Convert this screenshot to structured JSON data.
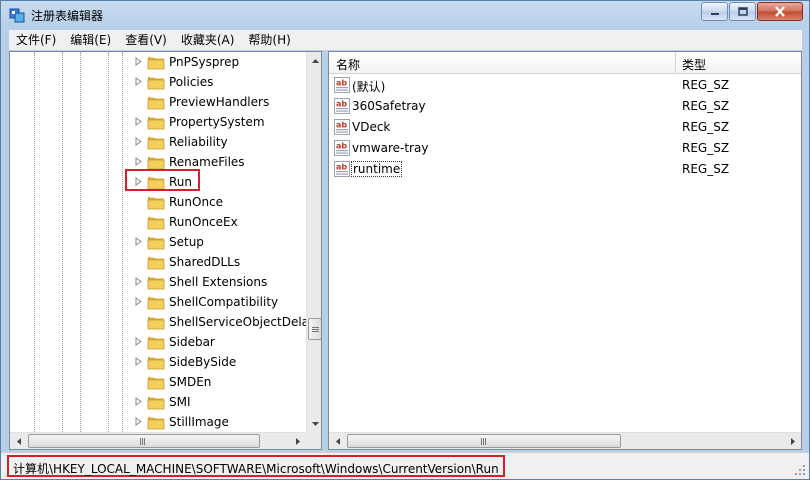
{
  "window": {
    "title": "注册表编辑器"
  },
  "menu": [
    {
      "label": "文件(F)"
    },
    {
      "label": "编辑(E)"
    },
    {
      "label": "查看(V)"
    },
    {
      "label": "收藏夹(A)"
    },
    {
      "label": "帮助(H)"
    }
  ],
  "tree": {
    "items": [
      {
        "label": "PnPSysprep",
        "expandable": true
      },
      {
        "label": "Policies",
        "expandable": true
      },
      {
        "label": "PreviewHandlers",
        "expandable": false
      },
      {
        "label": "PropertySystem",
        "expandable": true
      },
      {
        "label": "Reliability",
        "expandable": true
      },
      {
        "label": "RenameFiles",
        "expandable": true
      },
      {
        "label": "Run",
        "expandable": true,
        "selected": true
      },
      {
        "label": "RunOnce",
        "expandable": false
      },
      {
        "label": "RunOnceEx",
        "expandable": false
      },
      {
        "label": "Setup",
        "expandable": true
      },
      {
        "label": "SharedDLLs",
        "expandable": false
      },
      {
        "label": "Shell Extensions",
        "expandable": true
      },
      {
        "label": "ShellCompatibility",
        "expandable": true
      },
      {
        "label": "ShellServiceObjectDelay",
        "expandable": false
      },
      {
        "label": "Sidebar",
        "expandable": true
      },
      {
        "label": "SideBySide",
        "expandable": true
      },
      {
        "label": "SMDEn",
        "expandable": false
      },
      {
        "label": "SMI",
        "expandable": true
      },
      {
        "label": "StillImage",
        "expandable": true
      }
    ]
  },
  "list": {
    "columns": {
      "name": "名称",
      "type": "类型"
    },
    "rows": [
      {
        "name": "(默认)",
        "type": "REG_SZ"
      },
      {
        "name": "360Safetray",
        "type": "REG_SZ"
      },
      {
        "name": "VDeck",
        "type": "REG_SZ"
      },
      {
        "name": "vmware-tray",
        "type": "REG_SZ"
      },
      {
        "name": "runtime",
        "type": "REG_SZ",
        "focused": true
      }
    ]
  },
  "status": {
    "path": "计算机\\HKEY_LOCAL_MACHINE\\SOFTWARE\\Microsoft\\Windows\\CurrentVersion\\Run"
  },
  "colors": {
    "highlight_border": "#d81e2a",
    "folder": "#e8c04a",
    "ab_icon": "#c0392b"
  },
  "icons": {
    "app": "regedit-icon",
    "folder": "folder-icon",
    "expander": "expand-arrow-icon",
    "value": "string-value-ab-icon",
    "minimize": "minimize-icon",
    "maximize": "maximize-icon",
    "close": "close-icon"
  }
}
